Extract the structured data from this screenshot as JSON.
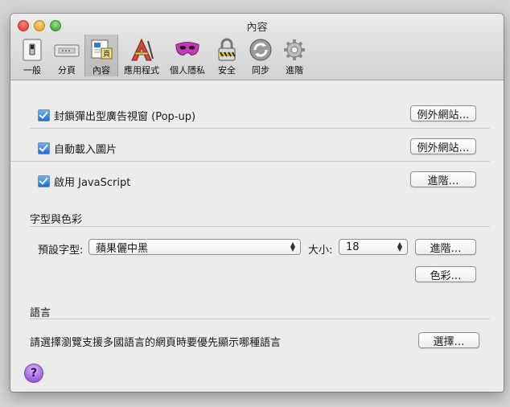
{
  "window": {
    "title": "內容"
  },
  "toolbar": {
    "items": [
      {
        "label": "一般",
        "icon": "switch-icon"
      },
      {
        "label": "分頁",
        "icon": "tabs-icon"
      },
      {
        "label": "內容",
        "icon": "content-icon",
        "active": true
      },
      {
        "label": "應用程式",
        "icon": "apps-icon"
      },
      {
        "label": "個人隱私",
        "icon": "mask-icon"
      },
      {
        "label": "安全",
        "icon": "lock-icon"
      },
      {
        "label": "同步",
        "icon": "sync-icon"
      },
      {
        "label": "進階",
        "icon": "gear-icon"
      }
    ]
  },
  "content": {
    "popup": {
      "label": "封鎖彈出型廣告視窗 (Pop-up)",
      "checked": true,
      "button": "例外網站…"
    },
    "images": {
      "label": "自動載入圖片",
      "checked": true,
      "button": "例外網站…"
    },
    "javascript": {
      "label": "啟用 JavaScript",
      "checked": true,
      "button": "進階…"
    },
    "fonts": {
      "section_title": "字型與色彩",
      "default_font_label": "預設字型:",
      "default_font_value": "蘋果儷中黑",
      "size_label": "大小:",
      "size_value": "18",
      "advanced_button": "進階…",
      "colors_button": "色彩…"
    },
    "languages": {
      "section_title": "語言",
      "description": "請選擇瀏覽支援多國語言的網頁時要優先顯示哪種語言",
      "choose_button": "選擇…"
    },
    "help": {
      "label": "?"
    }
  },
  "colors": {
    "accent": "#1e69de",
    "window_bg": "#ececec",
    "help": "#9b59d6"
  }
}
